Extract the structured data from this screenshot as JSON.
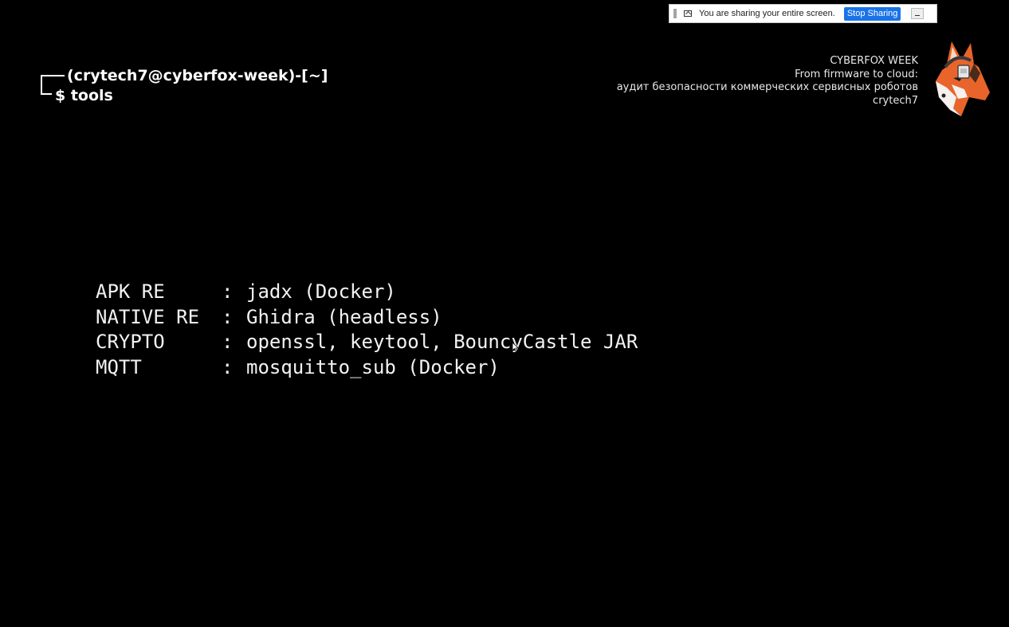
{
  "share_bar": {
    "message": "You are sharing your entire screen.",
    "stop_label": "Stop Sharing"
  },
  "prompt": {
    "line1": "(crytech7@cyberfox-week)-[~]",
    "line2": "$ tools"
  },
  "event": {
    "title": "CYBERFOX WEEK",
    "subtitle": "From firmware to cloud:",
    "topic": "аудит безопасности коммерческих сервисных роботов",
    "author": "crytech7"
  },
  "tools": [
    {
      "category": "APK RE",
      "separator": ":",
      "value": "jadx (Docker)"
    },
    {
      "category": "NATIVE RE",
      "separator": ":",
      "value": "Ghidra (headless)"
    },
    {
      "category": "CRYPTO",
      "separator": ":",
      "value": "openssl, keytool, BouncyCastle JAR"
    },
    {
      "category": "MQTT",
      "separator": ":",
      "value": "mosquitto_sub (Docker)"
    }
  ],
  "colors": {
    "background": "#000000",
    "text": "#ffffff",
    "stop_button": "#1a73e8",
    "fox_orange": "#e8642a"
  },
  "icons": {
    "share": "share-screen-icon",
    "minimize": "minimize-icon",
    "logo": "fox-logo-icon"
  }
}
